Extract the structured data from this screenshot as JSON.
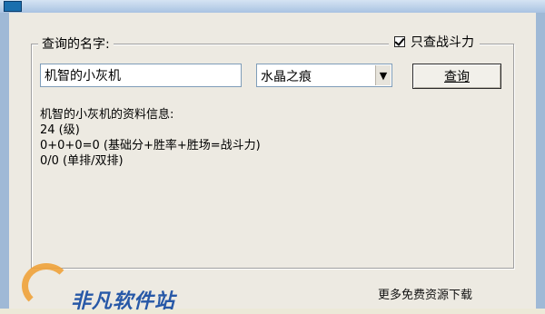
{
  "window": {
    "group_title": "查询的名字:",
    "only_check_label": "只查战斗力"
  },
  "form": {
    "name_value": "机智的小灰机",
    "server_value": "水晶之痕",
    "query_button": "查询"
  },
  "info": {
    "heading": "机智的小灰机的资料信息:",
    "line1": "24 (级)",
    "line2": "0+0+0=0  (基础分+胜率+胜场=战斗力)",
    "line3": "0/0 (单排/双排)"
  },
  "footer": {
    "logo_text": "非凡软件站",
    "right_text": "更多免费资源下载"
  }
}
